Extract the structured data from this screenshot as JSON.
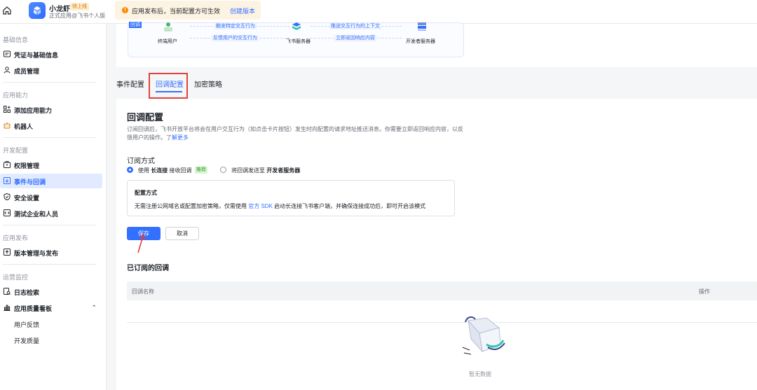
{
  "topbar": {
    "app_name": "小龙虾",
    "app_badge": "待上线",
    "app_sub": "正式应用@飞书个人版",
    "notice_text": "应用发布后，当前配置方可生效",
    "notice_link": "创建版本"
  },
  "sidebar": {
    "groups": [
      "基础信息",
      "应用能力",
      "开发配置",
      "应用发布",
      "运营监控"
    ],
    "items": [
      {
        "label": "凭证与基础信息",
        "icon": "credential-icon"
      },
      {
        "label": "成员管理",
        "icon": "user-icon"
      },
      {
        "label": "添加应用能力",
        "icon": "grid-add-icon"
      },
      {
        "label": "机器人",
        "icon": "robot-icon"
      },
      {
        "label": "权限管理",
        "icon": "key-icon"
      },
      {
        "label": "事件与回调",
        "icon": "event-icon"
      },
      {
        "label": "安全设置",
        "icon": "shield-icon"
      },
      {
        "label": "测试企业和人员",
        "icon": "code-icon"
      },
      {
        "label": "版本管理与发布",
        "icon": "upload-icon"
      },
      {
        "label": "日志检索",
        "icon": "log-icon"
      },
      {
        "label": "应用质量看板",
        "icon": "chart-icon"
      },
      {
        "label": "用户反馈",
        "icon": ""
      },
      {
        "label": "开发质量",
        "icon": ""
      }
    ]
  },
  "diagram": {
    "user_label": "终端用户",
    "server_label": "飞书服务器",
    "dev_label": "开发者服务器",
    "callback_tag": "回调",
    "pill1": "触发特定交互行为",
    "pill2": "反馈用户的交互行为",
    "pill3": "推送交互行为的上下文",
    "pill4": "立即返回响应内容"
  },
  "tabs": [
    "事件配置",
    "回调配置",
    "加密策略"
  ],
  "callback": {
    "title": "回调配置",
    "desc_1": "订阅回调后，飞书开放平台将会在用户交互行为（如点击卡片按钮）发生时向配置的请求地址推送消息。你需要立即返回响应内容，以反馈用户的操作。了",
    "desc_link": "解更多",
    "sub_title": "订阅方式",
    "option1_pre": "使用 ",
    "option1_bold": "长连接",
    "option1_post": " 接收回调",
    "option1_tag": "推荐",
    "option2_pre": "将回调发送至 ",
    "option2_bold": "开发者服务器",
    "mode_title": "配置方式",
    "mode_text_pre": "无需注册公网域名或配置加密策略，仅需使用 ",
    "mode_text_link": "官方 SDK",
    "mode_text_post": " 启动长连接飞书客户端，并确保连接成功后，即可开启该模式",
    "save": "保存",
    "cancel": "取消",
    "subscribed_title": "已订阅的回调",
    "col_name": "回调名称",
    "col_action": "操作",
    "empty": "暂无数据"
  }
}
